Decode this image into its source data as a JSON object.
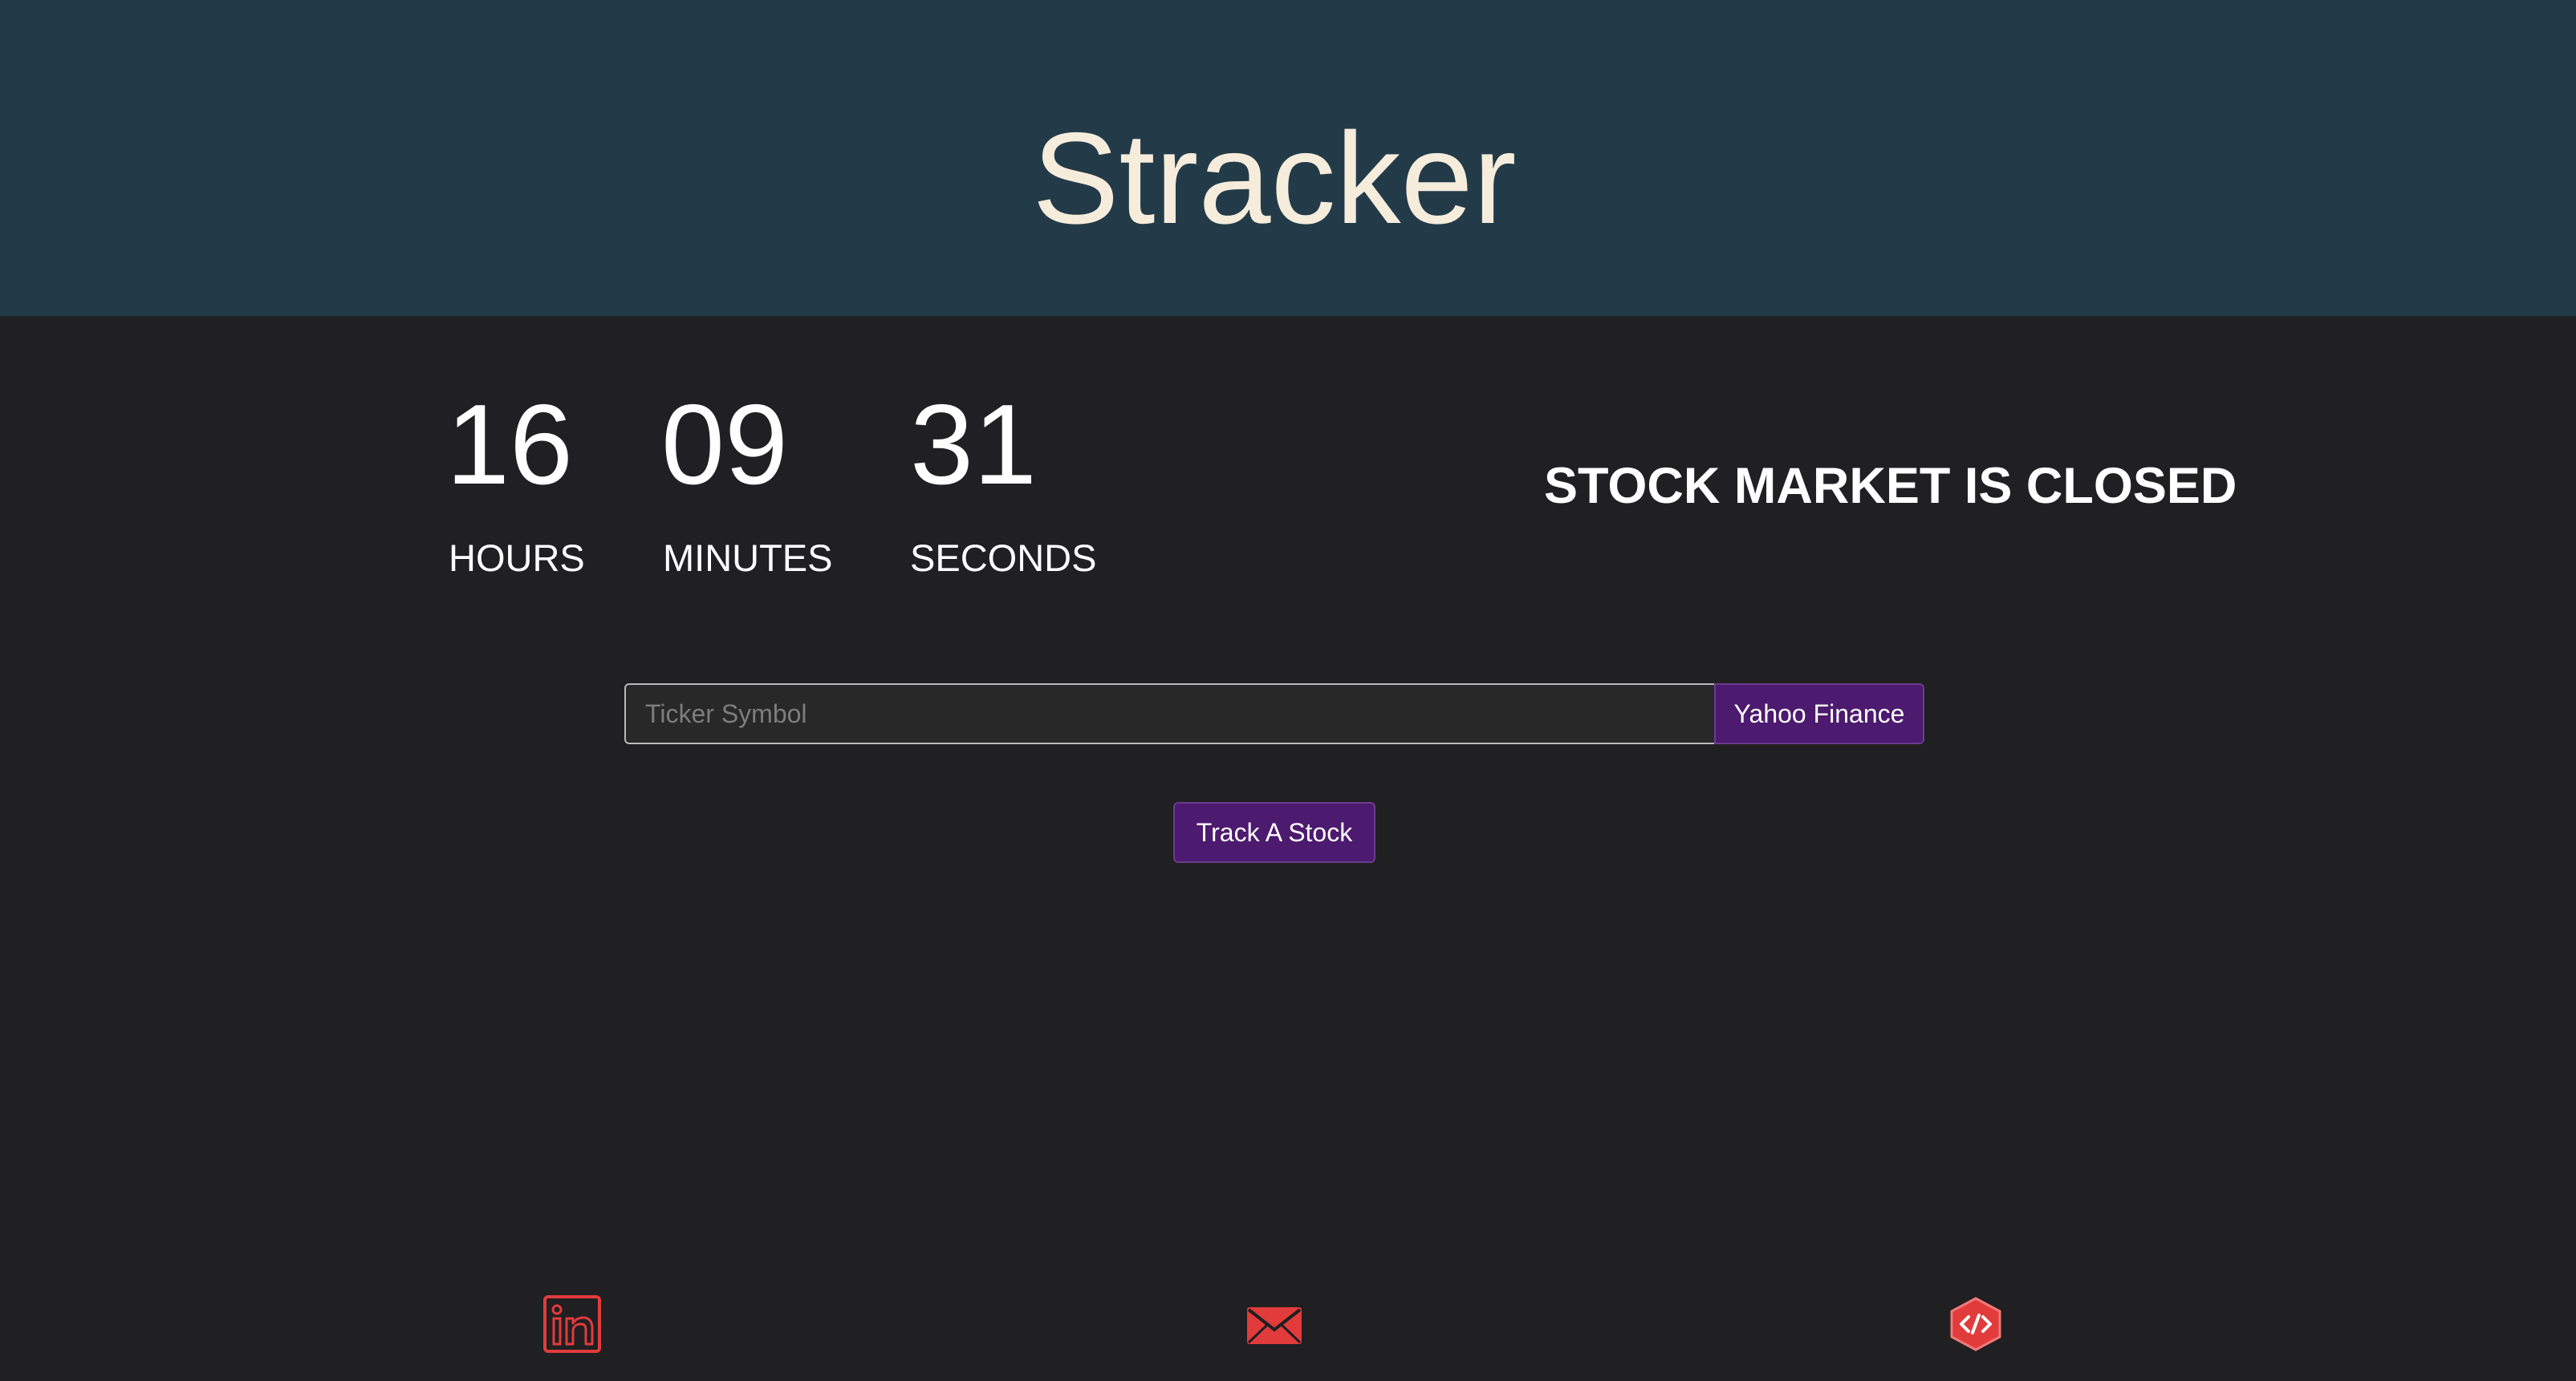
{
  "app": {
    "title": "Stracker"
  },
  "countdown": {
    "hours": "16",
    "minutes": "09",
    "seconds": "31",
    "hours_label": "HOURS",
    "minutes_label": "MINUTES",
    "seconds_label": "SECONDS"
  },
  "market": {
    "status": "STOCK MARKET IS CLOSED"
  },
  "search": {
    "placeholder": "Ticker Symbol",
    "value": "",
    "yahoo_label": "Yahoo Finance",
    "track_label": "Track A Stock"
  },
  "footer": {
    "icons": [
      "linkedin-icon",
      "mail-icon",
      "code-icon"
    ]
  },
  "colors": {
    "header_bg": "#233b49",
    "body_bg": "#201f22",
    "title": "#f6ecdc",
    "accent_purple": "#4c1a6e",
    "icon_red": "#e23b3b"
  }
}
